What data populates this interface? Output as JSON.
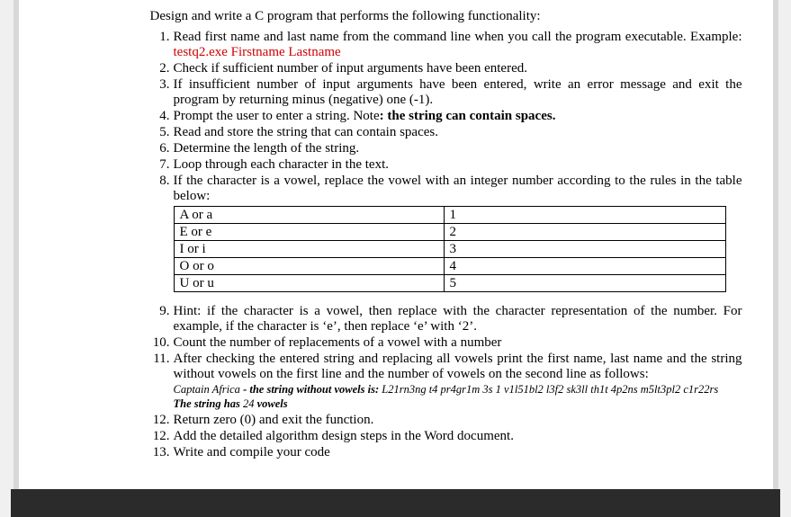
{
  "intro": "Design and write a C program that performs the following functionality:",
  "items": {
    "i1a": "Read first name and last name from the command line when you call the program executable. Example: ",
    "i1b": "testq2.exe Firstname Lastname",
    "i2": "Check if sufficient number of input arguments have been entered.",
    "i3": "If insufficient number of input arguments have been entered, write an error message and exit the program by returning minus (negative) one (-1).",
    "i4a": "Prompt the user to enter a string. Note",
    "i4b": ": the string can contain spaces.",
    "i5": "Read and store the string that can contain spaces.",
    "i6": "Determine the length of the string.",
    "i7": "Loop through each character in the text.",
    "i8": "If the character is a vowel, replace the vowel with an integer number according to the rules in the table below:",
    "i9": "Hint: if the character is a vowel, then replace with the character representation of the number. For example, if the character is ‘e’, then replace ‘e’ with ‘2’.",
    "i10": "Count the number of replacements of a vowel with a number",
    "i11": "After checking the entered string and replacing all vowels print the first name, last name and the string without vowels on the first line and the number of vowels on the second line as follows:",
    "i11out1a": "Captain Africa ",
    "i11out1b": "- the string without vowels is:",
    "i11out1c": " L21rn3ng t4 pr4gr1m 3s 1 v1l51bl2 l3f2 sk3ll th1t 4p2ns m5lt3pl2 c1r22rs",
    "i11out2a": "The string has ",
    "i11out2b": "24",
    "i11out2c": " vowels",
    "i12a": "Return zero (0) and exit the function.",
    "i12b": "Add the detailed algorithm design steps in the Word document.",
    "i13": "Write and compile your code"
  },
  "table": {
    "r1c1": "A or a",
    "r1c2": "1",
    "r2c1": "E or e",
    "r2c2": "2",
    "r3c1": "I or i",
    "r3c2": "3",
    "r4c1": "O or o",
    "r4c2": "4",
    "r5c1": "U or u",
    "r5c2": "5"
  }
}
